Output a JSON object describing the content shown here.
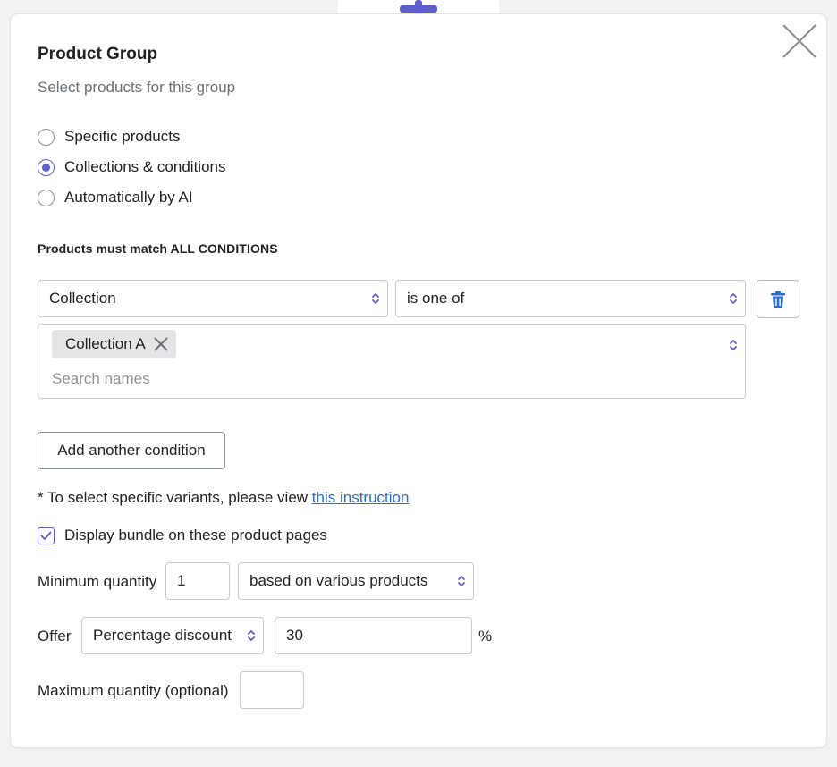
{
  "dialog": {
    "title": "Product Group",
    "subtitle": "Select products for this group"
  },
  "selection_mode": {
    "options": [
      {
        "label": "Specific products",
        "checked": false
      },
      {
        "label": "Collections & conditions",
        "checked": true
      },
      {
        "label": "Automatically by AI",
        "checked": false
      }
    ]
  },
  "conditions": {
    "heading": "Products must match ALL CONDITIONS",
    "field_value": "Collection",
    "operator_value": "is one of",
    "tags": [
      "Collection A"
    ],
    "search_placeholder": "Search names",
    "add_button": "Add another condition"
  },
  "note": {
    "prefix": "* To select specific variants, please view ",
    "link": "this instruction"
  },
  "display_bundle": {
    "label": "Display bundle on these product pages",
    "checked": true
  },
  "min_quantity": {
    "label": "Minimum quantity",
    "value": "1",
    "basis": "based on various products"
  },
  "offer": {
    "label": "Offer",
    "type": "Percentage discount",
    "value": "30",
    "unit": "%"
  },
  "max_quantity": {
    "label": "Maximum quantity (optional)",
    "value": ""
  },
  "colors": {
    "accent": "#5c5fcc",
    "link": "#2c6ecb",
    "delete_icon": "#2c6ecb"
  },
  "icons": {
    "add": "plus-icon",
    "close": "close-icon",
    "delete": "trash-icon",
    "tag_remove": "x-icon",
    "select": "select-caret-icon",
    "check": "checkmark-icon"
  }
}
